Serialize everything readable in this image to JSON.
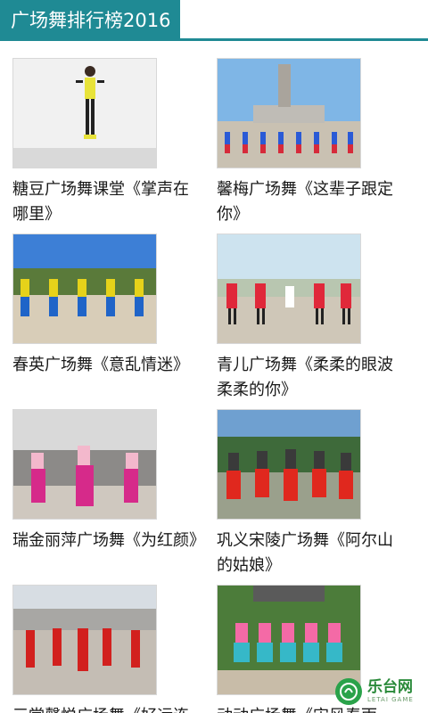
{
  "header": {
    "title": "广场舞排行榜2016"
  },
  "items": [
    {
      "title": "糖豆广场舞课堂《掌声在哪里》",
      "thumb_icon": "dancer-studio-thumbnail"
    },
    {
      "title": "馨梅广场舞《这辈子跟定你》",
      "thumb_icon": "dancers-monument-thumbnail"
    },
    {
      "title": "春英广场舞《意乱情迷》",
      "thumb_icon": "dancers-blue-sky-thumbnail"
    },
    {
      "title": "青儿广场舞《柔柔的眼波柔柔的你》",
      "thumb_icon": "dancers-plaza-thumbnail"
    },
    {
      "title": "瑞金丽萍广场舞《为红颜》",
      "thumb_icon": "dancers-pink-thumbnail"
    },
    {
      "title": "巩义宋陵广场舞《阿尔山的姑娘》",
      "thumb_icon": "dancers-red-thumbnail"
    },
    {
      "title": "三堂馨悦广场舞《好运连",
      "thumb_icon": "dancers-red-street-thumbnail"
    },
    {
      "title": "动动广场舞《宋风春雨",
      "thumb_icon": "dancers-garden-thumbnail"
    }
  ],
  "watermark": {
    "brand_cn": "乐台网",
    "brand_en": "LETAI GAME"
  }
}
